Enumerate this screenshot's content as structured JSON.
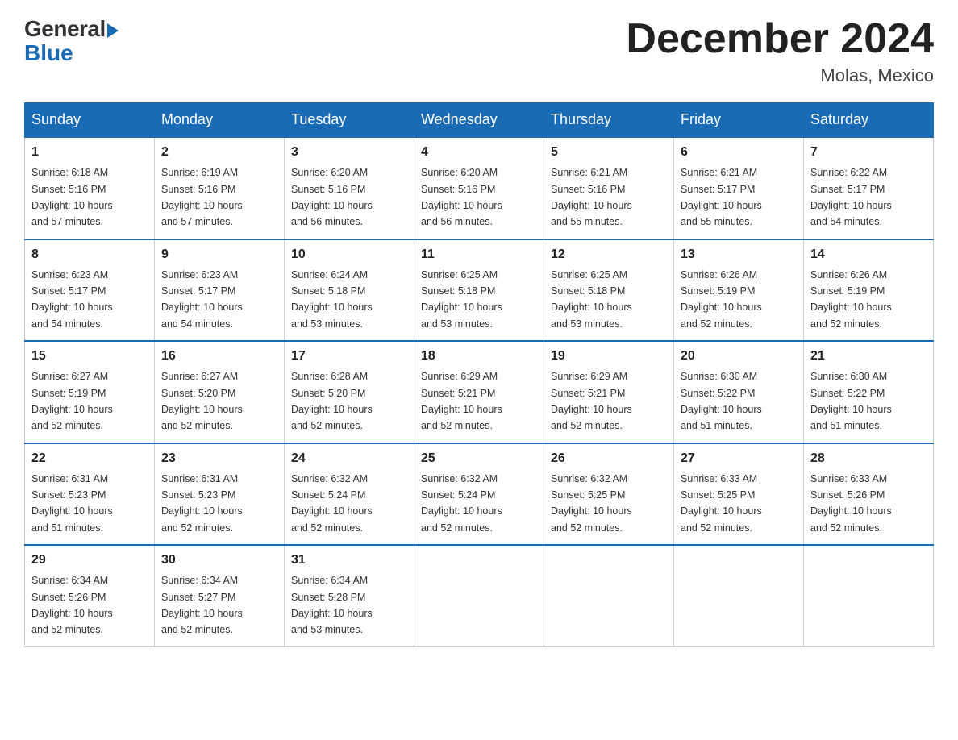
{
  "logo": {
    "general": "General",
    "blue": "Blue"
  },
  "header": {
    "month_title": "December 2024",
    "location": "Molas, Mexico"
  },
  "days_of_week": [
    "Sunday",
    "Monday",
    "Tuesday",
    "Wednesday",
    "Thursday",
    "Friday",
    "Saturday"
  ],
  "weeks": [
    [
      {
        "day": "1",
        "sunrise": "6:18 AM",
        "sunset": "5:16 PM",
        "daylight": "10 hours and 57 minutes."
      },
      {
        "day": "2",
        "sunrise": "6:19 AM",
        "sunset": "5:16 PM",
        "daylight": "10 hours and 57 minutes."
      },
      {
        "day": "3",
        "sunrise": "6:20 AM",
        "sunset": "5:16 PM",
        "daylight": "10 hours and 56 minutes."
      },
      {
        "day": "4",
        "sunrise": "6:20 AM",
        "sunset": "5:16 PM",
        "daylight": "10 hours and 56 minutes."
      },
      {
        "day": "5",
        "sunrise": "6:21 AM",
        "sunset": "5:16 PM",
        "daylight": "10 hours and 55 minutes."
      },
      {
        "day": "6",
        "sunrise": "6:21 AM",
        "sunset": "5:17 PM",
        "daylight": "10 hours and 55 minutes."
      },
      {
        "day": "7",
        "sunrise": "6:22 AM",
        "sunset": "5:17 PM",
        "daylight": "10 hours and 54 minutes."
      }
    ],
    [
      {
        "day": "8",
        "sunrise": "6:23 AM",
        "sunset": "5:17 PM",
        "daylight": "10 hours and 54 minutes."
      },
      {
        "day": "9",
        "sunrise": "6:23 AM",
        "sunset": "5:17 PM",
        "daylight": "10 hours and 54 minutes."
      },
      {
        "day": "10",
        "sunrise": "6:24 AM",
        "sunset": "5:18 PM",
        "daylight": "10 hours and 53 minutes."
      },
      {
        "day": "11",
        "sunrise": "6:25 AM",
        "sunset": "5:18 PM",
        "daylight": "10 hours and 53 minutes."
      },
      {
        "day": "12",
        "sunrise": "6:25 AM",
        "sunset": "5:18 PM",
        "daylight": "10 hours and 53 minutes."
      },
      {
        "day": "13",
        "sunrise": "6:26 AM",
        "sunset": "5:19 PM",
        "daylight": "10 hours and 52 minutes."
      },
      {
        "day": "14",
        "sunrise": "6:26 AM",
        "sunset": "5:19 PM",
        "daylight": "10 hours and 52 minutes."
      }
    ],
    [
      {
        "day": "15",
        "sunrise": "6:27 AM",
        "sunset": "5:19 PM",
        "daylight": "10 hours and 52 minutes."
      },
      {
        "day": "16",
        "sunrise": "6:27 AM",
        "sunset": "5:20 PM",
        "daylight": "10 hours and 52 minutes."
      },
      {
        "day": "17",
        "sunrise": "6:28 AM",
        "sunset": "5:20 PM",
        "daylight": "10 hours and 52 minutes."
      },
      {
        "day": "18",
        "sunrise": "6:29 AM",
        "sunset": "5:21 PM",
        "daylight": "10 hours and 52 minutes."
      },
      {
        "day": "19",
        "sunrise": "6:29 AM",
        "sunset": "5:21 PM",
        "daylight": "10 hours and 52 minutes."
      },
      {
        "day": "20",
        "sunrise": "6:30 AM",
        "sunset": "5:22 PM",
        "daylight": "10 hours and 51 minutes."
      },
      {
        "day": "21",
        "sunrise": "6:30 AM",
        "sunset": "5:22 PM",
        "daylight": "10 hours and 51 minutes."
      }
    ],
    [
      {
        "day": "22",
        "sunrise": "6:31 AM",
        "sunset": "5:23 PM",
        "daylight": "10 hours and 51 minutes."
      },
      {
        "day": "23",
        "sunrise": "6:31 AM",
        "sunset": "5:23 PM",
        "daylight": "10 hours and 52 minutes."
      },
      {
        "day": "24",
        "sunrise": "6:32 AM",
        "sunset": "5:24 PM",
        "daylight": "10 hours and 52 minutes."
      },
      {
        "day": "25",
        "sunrise": "6:32 AM",
        "sunset": "5:24 PM",
        "daylight": "10 hours and 52 minutes."
      },
      {
        "day": "26",
        "sunrise": "6:32 AM",
        "sunset": "5:25 PM",
        "daylight": "10 hours and 52 minutes."
      },
      {
        "day": "27",
        "sunrise": "6:33 AM",
        "sunset": "5:25 PM",
        "daylight": "10 hours and 52 minutes."
      },
      {
        "day": "28",
        "sunrise": "6:33 AM",
        "sunset": "5:26 PM",
        "daylight": "10 hours and 52 minutes."
      }
    ],
    [
      {
        "day": "29",
        "sunrise": "6:34 AM",
        "sunset": "5:26 PM",
        "daylight": "10 hours and 52 minutes."
      },
      {
        "day": "30",
        "sunrise": "6:34 AM",
        "sunset": "5:27 PM",
        "daylight": "10 hours and 52 minutes."
      },
      {
        "day": "31",
        "sunrise": "6:34 AM",
        "sunset": "5:28 PM",
        "daylight": "10 hours and 53 minutes."
      },
      null,
      null,
      null,
      null
    ]
  ],
  "sunrise_label": "Sunrise:",
  "sunset_label": "Sunset:",
  "daylight_label": "Daylight:"
}
